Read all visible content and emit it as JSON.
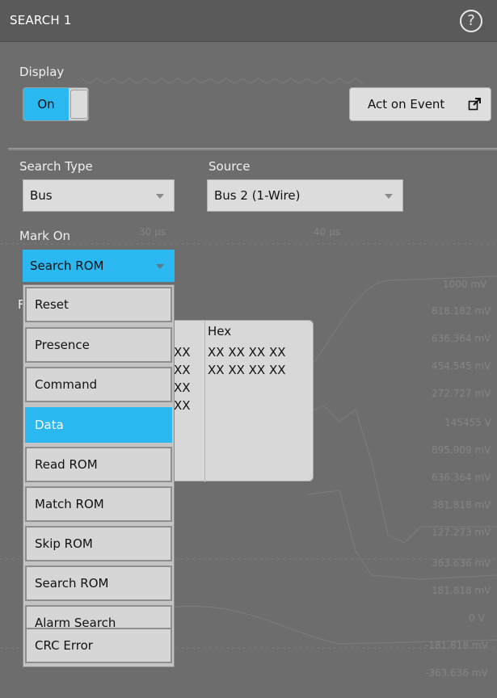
{
  "header": {
    "title": "SEARCH 1",
    "help_icon": "?"
  },
  "display": {
    "label": "Display",
    "toggle_label": "On"
  },
  "act_on_event": {
    "label": "Act on Event"
  },
  "search_type": {
    "label": "Search Type",
    "value": "Bus"
  },
  "source": {
    "label": "Source",
    "value": "Bus 2 (1-Wire)"
  },
  "mark_on": {
    "label": "Mark On",
    "value": "Search ROM",
    "options": [
      "Reset",
      "Presence",
      "Command",
      "Data",
      "Read ROM",
      "Match ROM",
      "Skip ROM",
      "Search ROM",
      "Alarm Search",
      "CRC Error"
    ],
    "highlighted": "Data"
  },
  "results": {
    "partial_label": "F",
    "hex_header": "Hex",
    "hex_rows": [
      "XX XX XX XX",
      "XX XX XX XX"
    ],
    "bin_rows": [
      "XX",
      "XX",
      "XX",
      "XX"
    ]
  },
  "background": {
    "time_labels": [
      "30 μs",
      "40 μs"
    ],
    "voltage_labels": [
      "1000 mV",
      "818.182 mV",
      "636.364 mV",
      "454.545 mV",
      "272.727 mV",
      "145455 V",
      "895.909 mV",
      "636.364 mV",
      "381.818 mV",
      "127.273 mV",
      "363.636 mV",
      "181.818 mV",
      "0 V",
      "-181.818 mV",
      "-363.636 mV"
    ]
  },
  "colors": {
    "accent": "#2bb7ef",
    "panel": "#6d6d6d",
    "header": "#5a5a5a"
  }
}
